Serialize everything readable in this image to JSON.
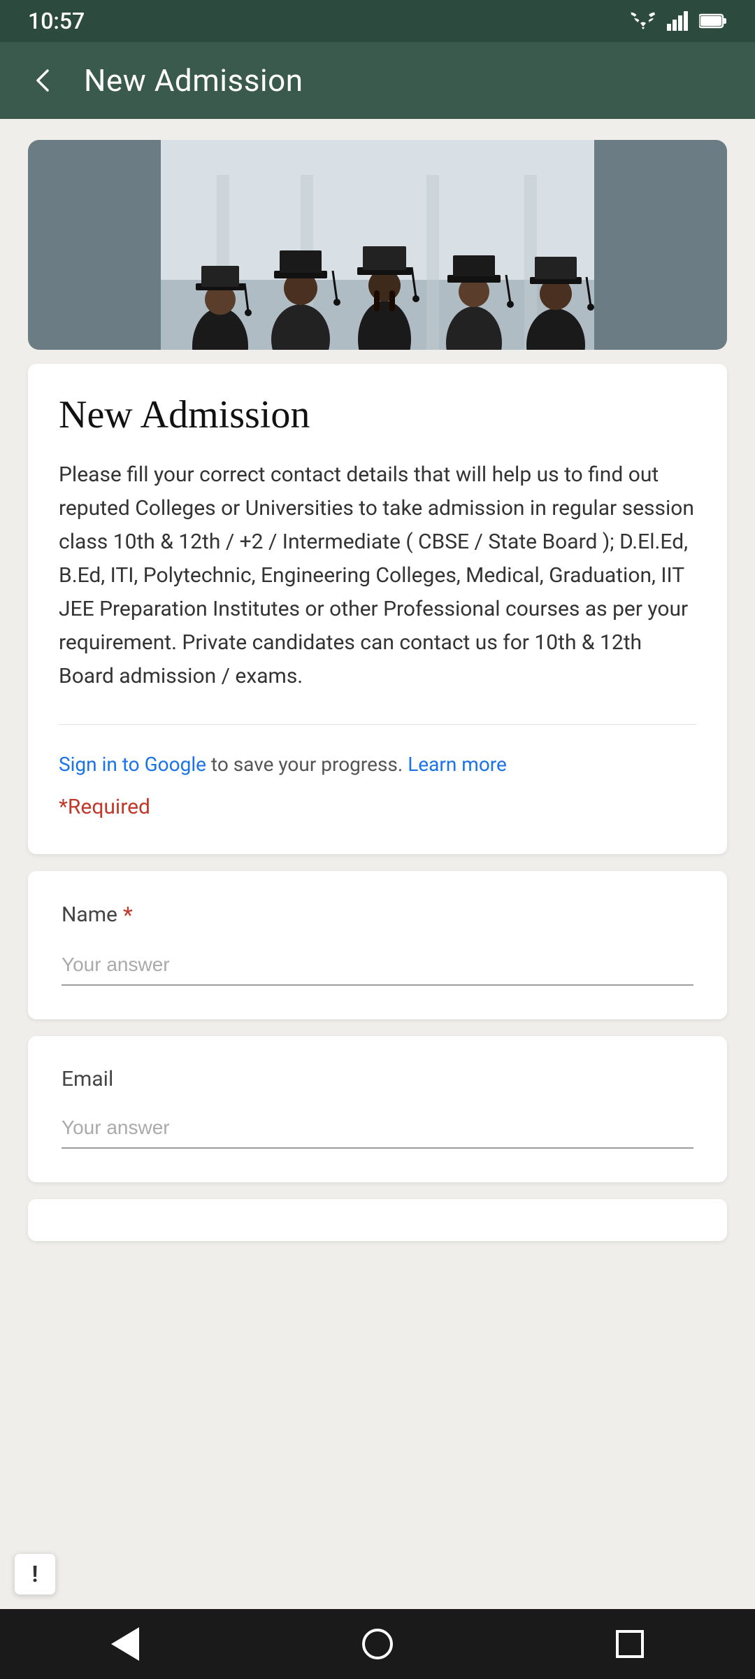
{
  "statusBar": {
    "time": "10:57"
  },
  "appBar": {
    "title": "New Admission",
    "backLabel": "back"
  },
  "heroImage": {
    "altText": "Graduation ceremony with students wearing caps and gowns"
  },
  "contentCard": {
    "title": "New Admission",
    "bodyText": "Please fill your correct contact details that will help us to find out reputed Colleges or Universities to take admission in regular session class 10th & 12th / +2 / Intermediate  ( CBSE / State Board ); D.El.Ed, B.Ed, ITI, Polytechnic, Engineering Colleges,  Medical, Graduation, IIT JEE Preparation Institutes or other Professional courses as per your requirement. Private candidates can contact us for 10th & 12th Board admission / exams.",
    "signInText": " to save your progress. ",
    "signInLink": "Sign in to Google",
    "learnMoreLink": "Learn more",
    "requiredText": "*Required"
  },
  "nameField": {
    "label": "Name",
    "placeholder": "Your answer",
    "required": true
  },
  "emailField": {
    "label": "Email",
    "placeholder": "Your answer",
    "required": false
  },
  "feedbackButton": {
    "icon": "!"
  },
  "bottomNav": {
    "backLabel": "back",
    "homeLabel": "home",
    "recentLabel": "recent"
  }
}
